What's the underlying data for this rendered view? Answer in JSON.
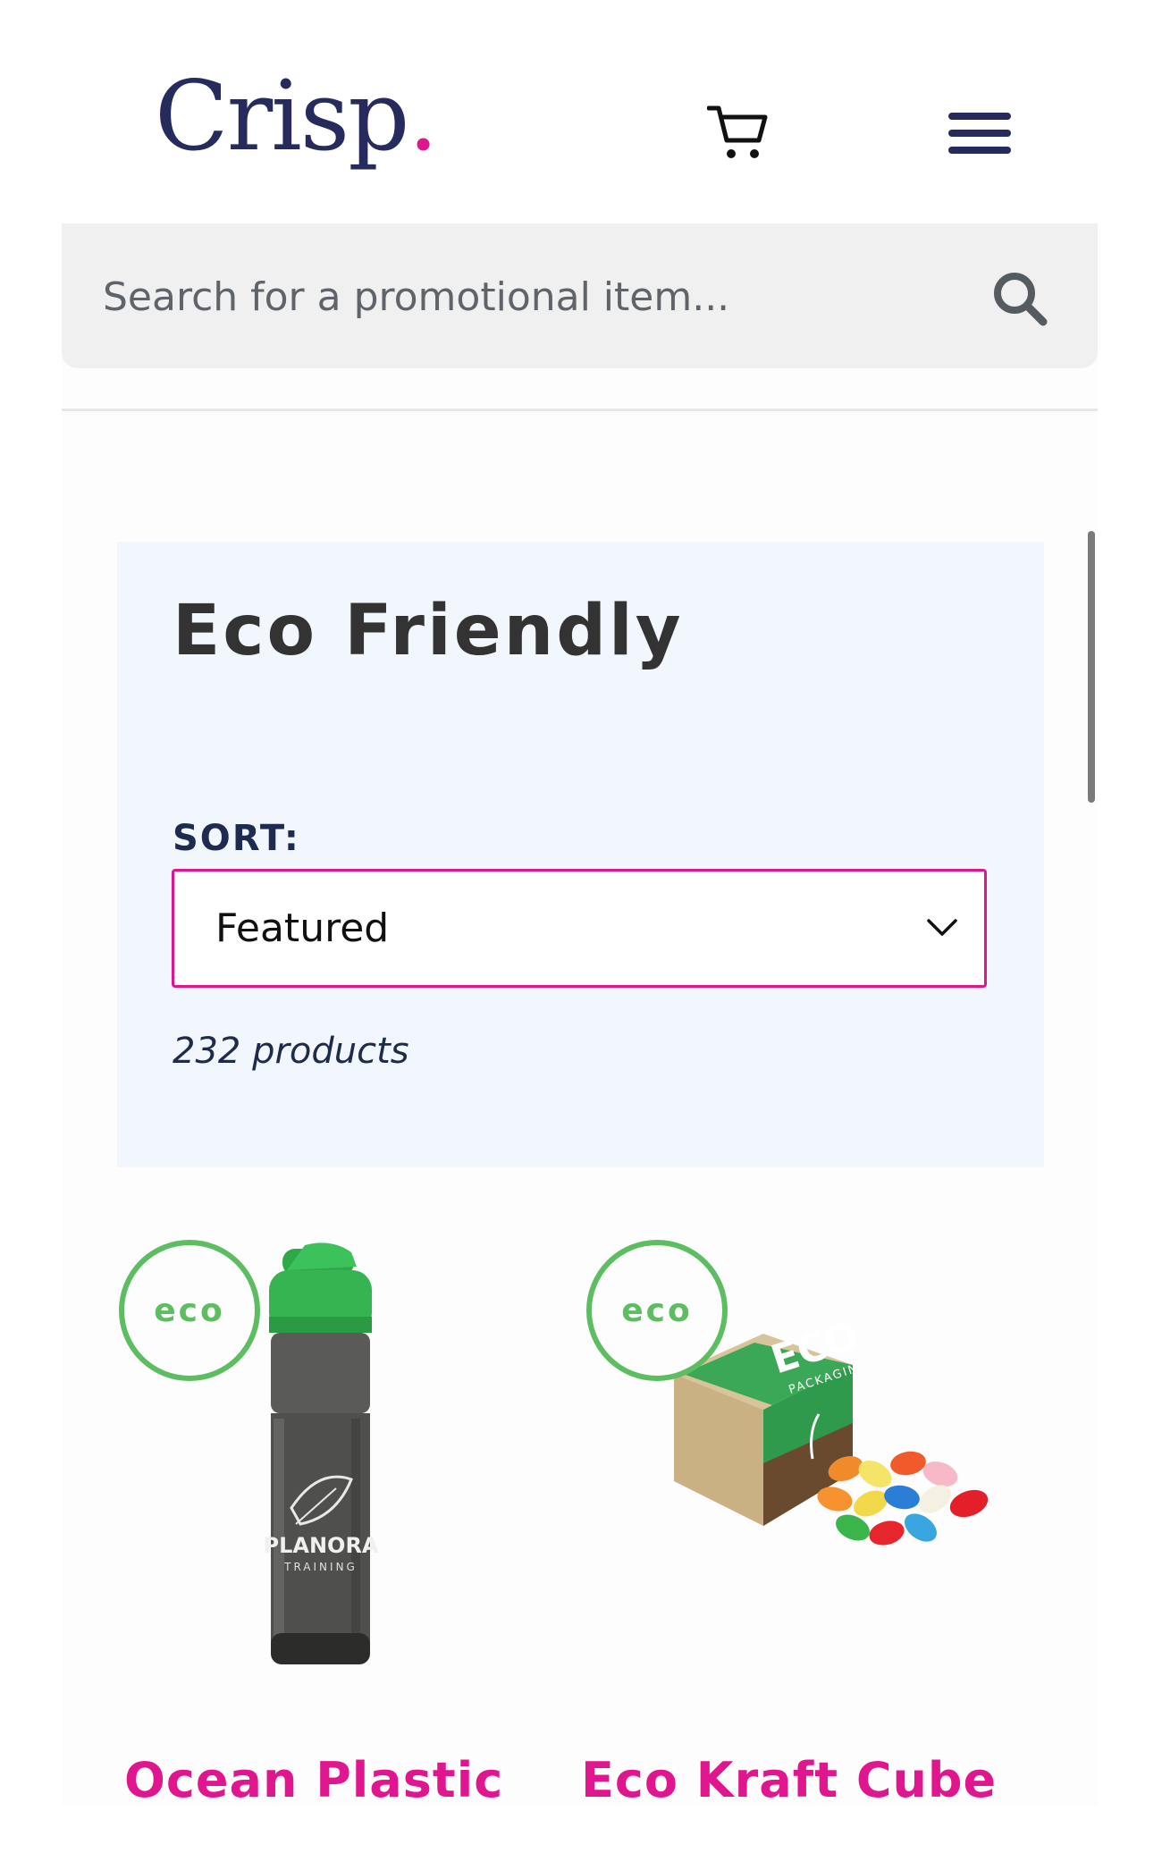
{
  "header": {
    "logo_text": "Crisp",
    "logo_dot": ".",
    "cart_icon": "cart-icon",
    "menu_icon": "hamburger-menu-icon"
  },
  "search": {
    "placeholder": "Search for a promotional item...",
    "icon": "search-icon"
  },
  "category": {
    "title": "Eco Friendly",
    "sort_label": "SORT:",
    "sort_selected": "Featured",
    "product_count": "232 products"
  },
  "products": [
    {
      "badge": "eco",
      "title": "Ocean Plastic Flip Lid Bottle",
      "image_print": "PLANORA",
      "image_print_sub": "TRAINING"
    },
    {
      "badge": "eco",
      "title": "Eco Kraft Cube Jelly Beans",
      "image_print": "ECO",
      "image_print_sub": "PACKAGING"
    }
  ],
  "colors": {
    "brand_navy": "#262a5c",
    "accent_pink": "#e0168e",
    "eco_green": "#5cbd61"
  }
}
